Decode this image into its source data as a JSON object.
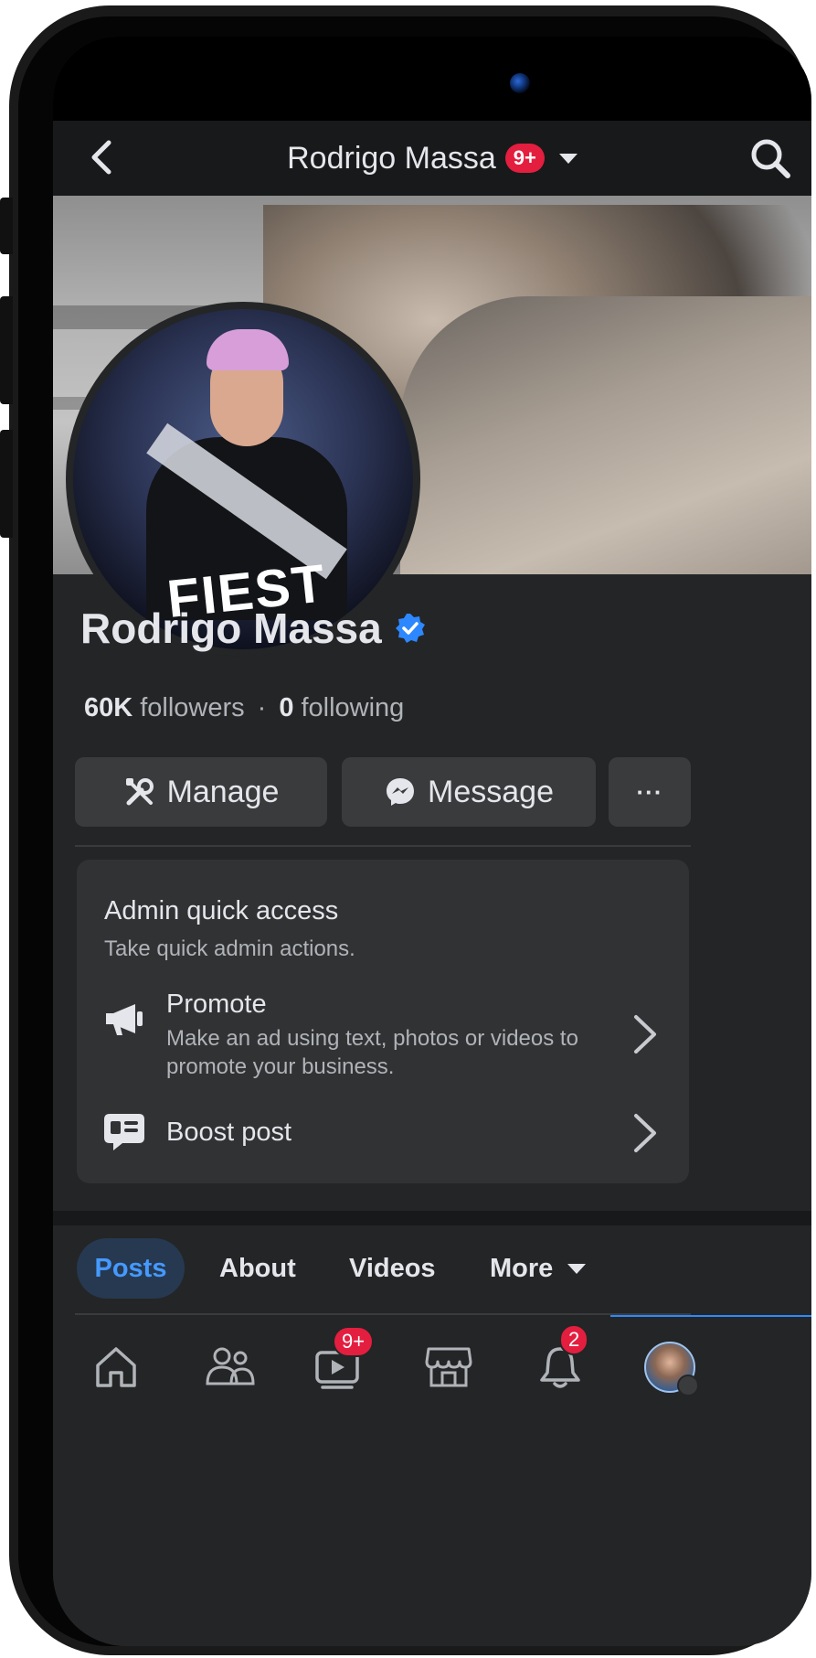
{
  "header": {
    "title": "Rodrigo Massa",
    "notification_badge": "9+"
  },
  "profile": {
    "name": "Rodrigo Massa",
    "avatar_text": "FIEST",
    "followers_count": "60K",
    "followers_label": "followers",
    "separator": "·",
    "following_count": "0",
    "following_label": "following"
  },
  "actions": {
    "manage_label": "Manage",
    "message_label": "Message",
    "more_label": "···"
  },
  "admin": {
    "title": "Admin quick access",
    "subtitle": "Take quick admin actions.",
    "items": [
      {
        "title": "Promote",
        "description": "Make an ad using text, photos or videos to promote your business.",
        "icon": "megaphone-icon"
      },
      {
        "title": "Boost post",
        "description": "",
        "icon": "boost-post-icon"
      }
    ]
  },
  "tabs": [
    {
      "label": "Posts",
      "active": true
    },
    {
      "label": "About"
    },
    {
      "label": "Videos"
    },
    {
      "label": "More"
    }
  ],
  "bottom_nav": {
    "items": [
      "home-icon",
      "friends-icon",
      "video-icon",
      "marketplace-icon",
      "notifications-icon",
      "profile-icon"
    ],
    "video_badge": "9+",
    "notifications_badge": "2"
  },
  "colors": {
    "background": "#242526",
    "card": "#313233",
    "button": "#3a3b3c",
    "text_primary": "#e4e6eb",
    "text_secondary": "#b0b3b8",
    "accent_blue": "#2d88ff",
    "badge_red": "#e41e3f"
  }
}
